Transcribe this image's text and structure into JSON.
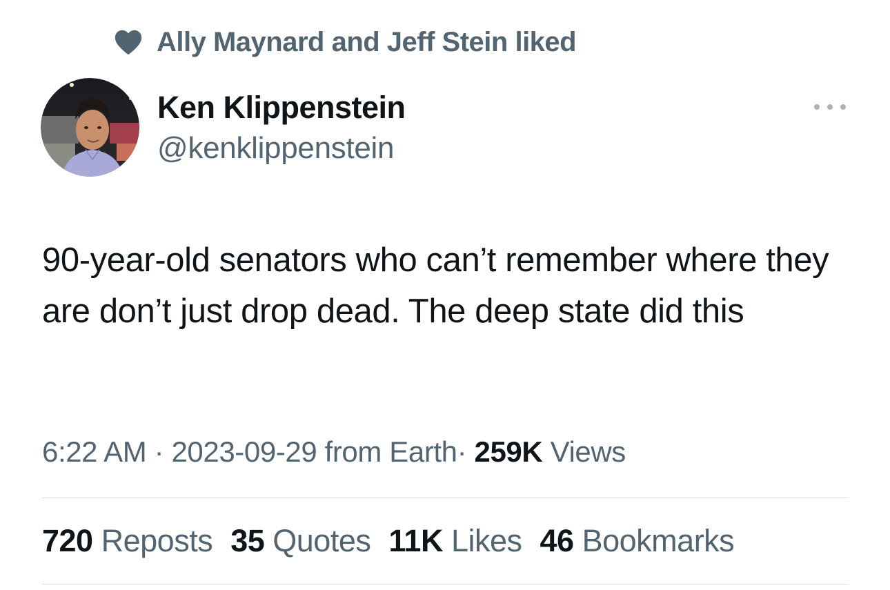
{
  "social_context": {
    "icon": "heart-icon",
    "text": "Ally Maynard and Jeff Stein liked"
  },
  "author": {
    "name": "Ken Klippenstein",
    "handle": "@kenklippenstein"
  },
  "tweet": {
    "text": "90-year-old senators who can’t remember where they are don’t just drop dead. The deep state did this"
  },
  "meta": {
    "time": "6:22 AM",
    "separator": "·",
    "date": "2023-09-29",
    "source": "from Earth",
    "views_count": "259K",
    "views_label": "Views"
  },
  "stats": [
    {
      "count": "720",
      "label": "Reposts"
    },
    {
      "count": "35",
      "label": "Quotes"
    },
    {
      "count": "11K",
      "label": "Likes"
    },
    {
      "count": "46",
      "label": "Bookmarks"
    }
  ],
  "colors": {
    "primary_text": "#0f1419",
    "secondary_text": "#536471",
    "divider": "#d8dde1"
  }
}
